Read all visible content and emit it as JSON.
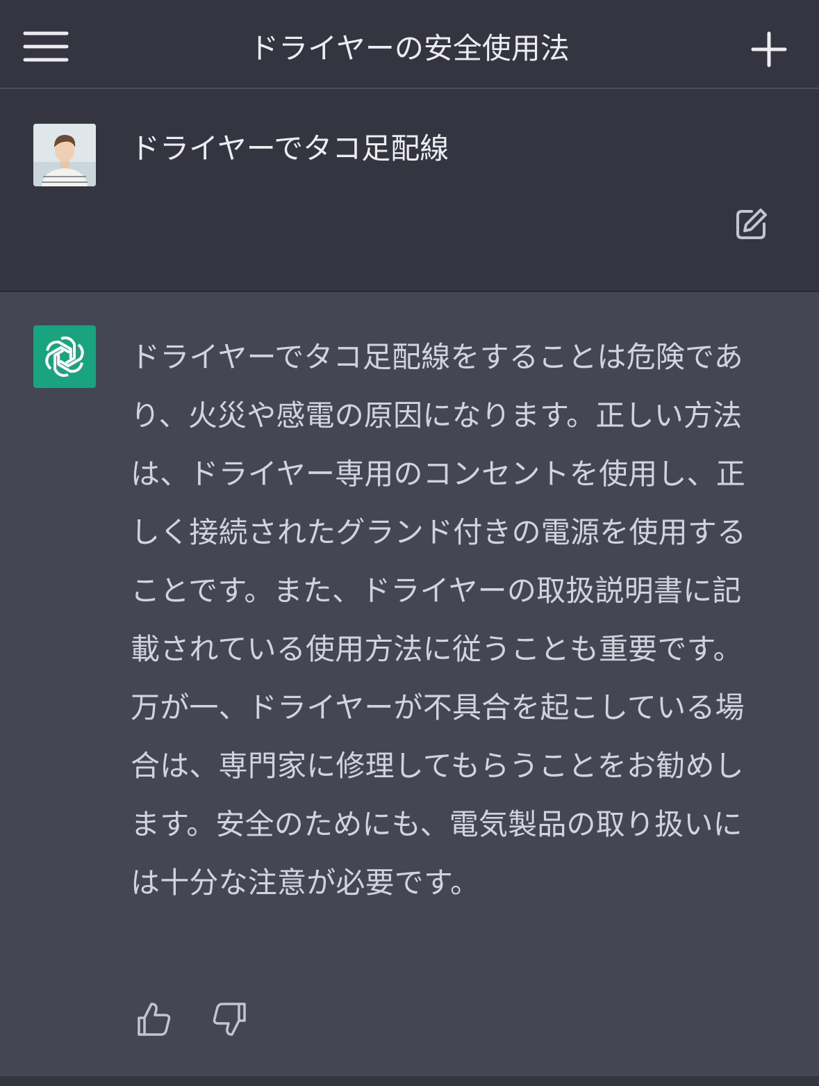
{
  "header": {
    "title": "ドライヤーの安全使用法",
    "menu_icon": "hamburger-menu-icon",
    "new_chat_icon": "plus-icon"
  },
  "user_message": {
    "text": "ドライヤーでタコ足配線",
    "avatar": "user-avatar-photo",
    "edit_icon": "edit-icon"
  },
  "assistant_message": {
    "text": "ドライヤーでタコ足配線をすることは危険であり、火災や感電の原因になります。正しい方法は、ドライヤー専用のコンセントを使用し、正しく接続されたグランド付きの電源を使用することです。また、ドライヤーの取扱説明書に記載されている使用方法に従うことも重要です。万が一、ドライヤーが不具合を起こしている場合は、専門家に修理してもらうことをお勧めします。安全のためにも、電気製品の取り扱いには十分な注意が必要です。",
    "logo_icon": "openai-logo-icon",
    "feedback": {
      "up_icon": "thumbs-up-icon",
      "down_icon": "thumbs-down-icon"
    }
  },
  "colors": {
    "background": "#343541",
    "assistant_background": "#444654",
    "brand_green": "#19a37f",
    "text": "#ececf1"
  }
}
